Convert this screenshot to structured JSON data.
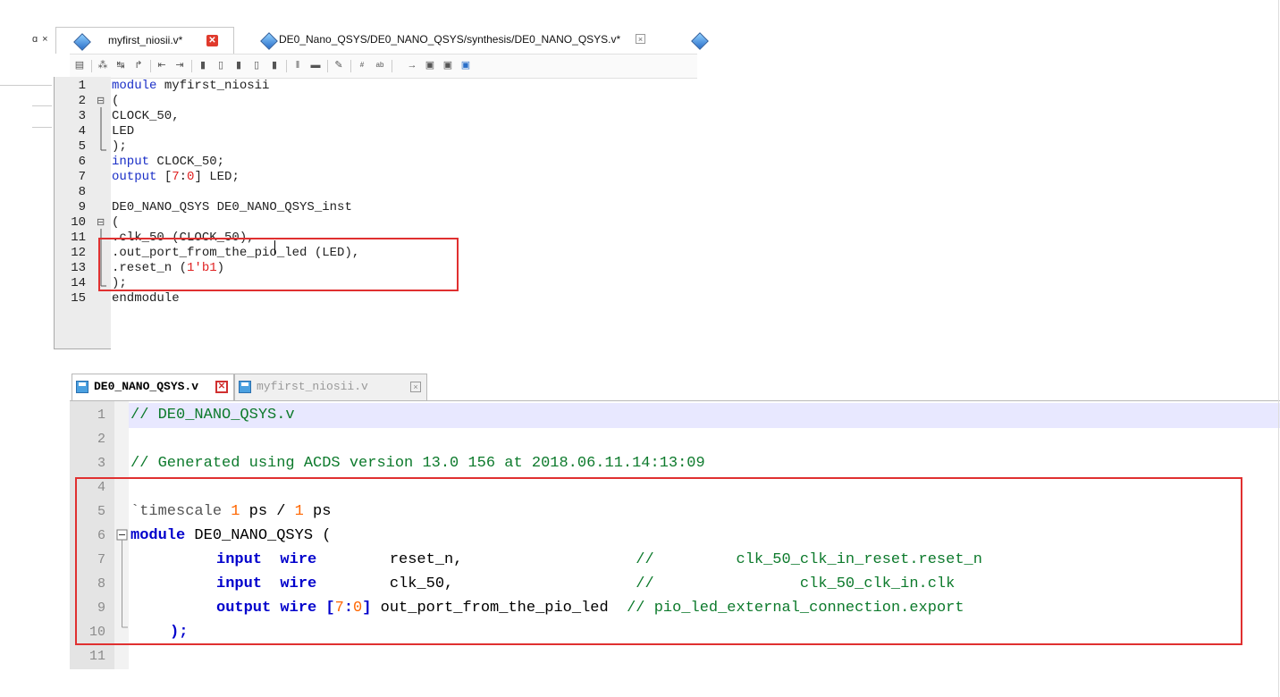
{
  "top_window": {
    "panel_controls": "ɑ ×",
    "tabs": [
      {
        "label": "myfirst_niosii.v*",
        "active": true
      },
      {
        "label": "DE0_Nano_QSYS/DE0_NANO_QSYS/synthesis/DE0_NANO_QSYS.v*",
        "active": false
      }
    ],
    "toolbar_icons": [
      "sidebar-icon",
      "find-icon",
      "find-replace-icon",
      "goto-line-icon",
      "indent-left-icon",
      "indent-right-icon",
      "comment-icon",
      "uncomment-icon",
      "bookmark-icon",
      "bookmark-next-icon",
      "bookmark-clear-icon",
      "insert-icon",
      "template-icon",
      "check-icon",
      "line-number-icon",
      "abc-icon",
      "arrow-icon",
      "panel-icon-a",
      "panel-icon-b",
      "panel-icon-c"
    ],
    "code_lines": [
      {
        "num": "1",
        "text": "module myfirst_niosii"
      },
      {
        "num": "2",
        "text": "("
      },
      {
        "num": "3",
        "text": "CLOCK_50,"
      },
      {
        "num": "4",
        "text": "LED"
      },
      {
        "num": "5",
        "text": ");"
      },
      {
        "num": "6",
        "text": "input CLOCK_50;"
      },
      {
        "num": "7",
        "text": "output [7:0] LED;"
      },
      {
        "num": "8",
        "text": ""
      },
      {
        "num": "9",
        "text": "DE0_NANO_QSYS DE0_NANO_QSYS_inst"
      },
      {
        "num": "10",
        "text": "("
      },
      {
        "num": "11",
        "text": ".clk_50 (CLOCK_50),"
      },
      {
        "num": "12",
        "text": ".out_port_from_the_pio_led (LED),"
      },
      {
        "num": "13",
        "text": ".reset_n (1'b1)"
      },
      {
        "num": "14",
        "text": ");"
      },
      {
        "num": "15",
        "text": "endmodule"
      }
    ],
    "parts": {
      "module_kw": "module",
      "module_name": " myfirst_niosii",
      "input_kw": "input",
      "input_rest": " CLOCK_50;",
      "output_kw": "output",
      "output_pre": " [",
      "output_hi": "7",
      "output_colon": ":",
      "output_lo": "0",
      "output_post": "] LED;",
      "reset_pre": ".reset_n (",
      "reset_lit": "1'b1",
      "reset_post": ")"
    }
  },
  "bottom_window": {
    "tabs": [
      {
        "label": "DE0_NANO_QSYS.v",
        "active": true
      },
      {
        "label": "myfirst_niosii.v",
        "active": false
      }
    ],
    "line_numbers": [
      "1",
      "2",
      "3",
      "4",
      "5",
      "6",
      "7",
      "8",
      "9",
      "10",
      "11"
    ],
    "lines": {
      "l1": "// DE0_NANO_QSYS.v",
      "l3": "// Generated using ACDS version 13.0 156 at 2018.06.11.14:13:09",
      "l5_directive": "`timescale ",
      "l5_n1": "1",
      "l5_mid": " ps / ",
      "l5_n2": "1",
      "l5_end": " ps",
      "l6_kw": "module",
      "l6_rest": " DE0_NANO_QSYS (",
      "l7_kw": "input  wire",
      "l7_sig": "        reset_n,                   ",
      "l7_cmt": "//         clk_50_clk_in_reset.reset_n",
      "l8_kw": "input  wire",
      "l8_sig": "        clk_50,                    ",
      "l8_cmt": "//                clk_50_clk_in.clk",
      "l9_kw": "output wire",
      "l9_br1": " [",
      "l9_hi": "7",
      "l9_colon": ":",
      "l9_lo": "0",
      "l9_br2": "]",
      "l9_sig": " out_port_from_the_pio_led  ",
      "l9_cmt": "// pio_led_external_connection.export",
      "l10": ");"
    }
  },
  "colors": {
    "highlight_box": "#e03030",
    "keyword_blue": "#0000cc",
    "comment_green": "#0d7a2c",
    "number_orange": "#ff6600"
  }
}
